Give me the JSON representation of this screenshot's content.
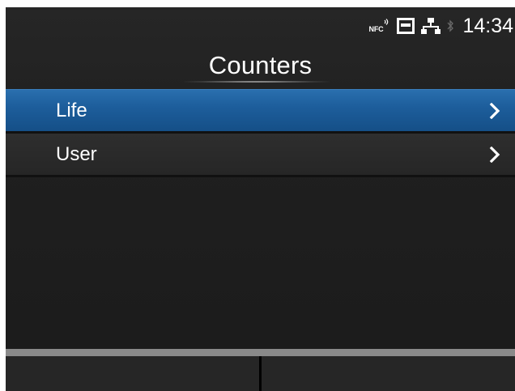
{
  "status": {
    "nfc_label": "NFC",
    "time": "14:34",
    "icons": [
      "nfc-icon",
      "sd-card-icon",
      "network-icon",
      "bluetooth-icon"
    ]
  },
  "page": {
    "title": "Counters"
  },
  "menu": {
    "items": [
      {
        "label": "Life",
        "selected": true
      },
      {
        "label": "User",
        "selected": false
      }
    ]
  },
  "softkeys": {
    "left_label": "",
    "right_label": ""
  },
  "colors": {
    "selection": "#1d5e9c",
    "background": "#1f1f1f",
    "text": "#ffffff"
  }
}
